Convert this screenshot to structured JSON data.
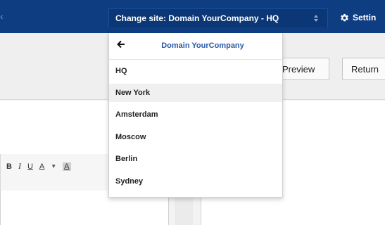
{
  "header": {
    "site_selector_label": "Change site: Domain YourCompany - HQ",
    "settings_label": "Settin"
  },
  "toolbar": {
    "preview_label": "Preview",
    "return_label": "Return"
  },
  "dropdown": {
    "title": "Domain YourCompany",
    "items": [
      {
        "label": "HQ"
      },
      {
        "label": "New York"
      },
      {
        "label": "Amsterdam"
      },
      {
        "label": "Moscow"
      },
      {
        "label": "Berlin"
      },
      {
        "label": "Sydney"
      }
    ]
  },
  "editor": {
    "format_buttons": {
      "bold": "B",
      "italic": "I",
      "underline": "U",
      "font_color": "A",
      "highlight": "A"
    }
  },
  "colors": {
    "topbar": "#0e3d82",
    "link_blue": "#2a5aa6",
    "hover_row": "#f0f0f0"
  }
}
